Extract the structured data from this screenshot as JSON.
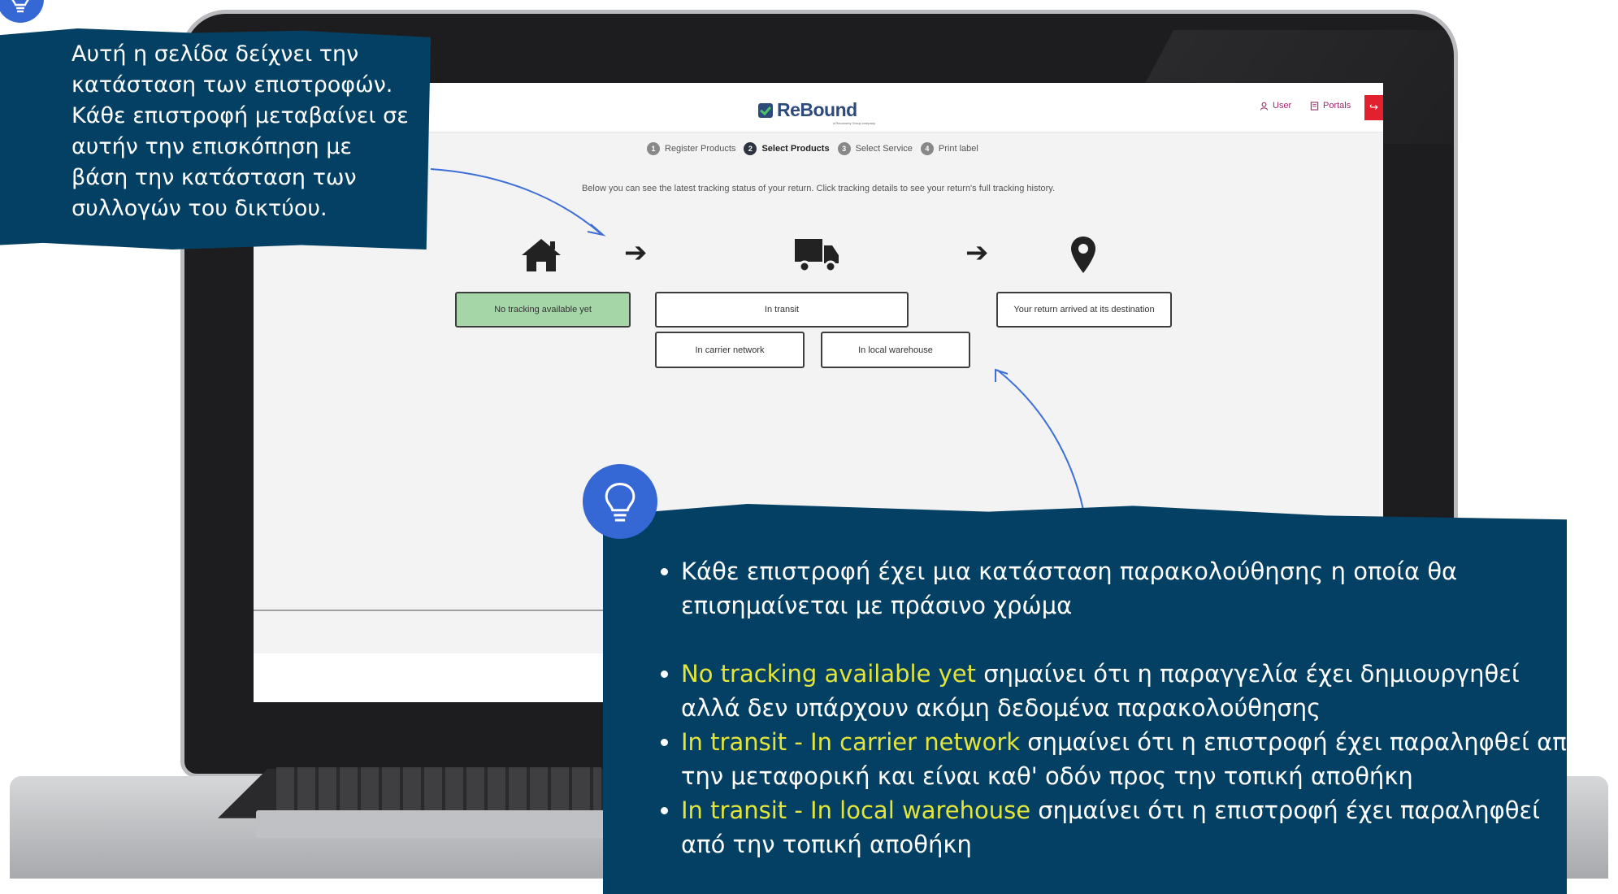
{
  "app": {
    "logo_text": "ReBound",
    "logo_subtext": "a Reconomy Group company",
    "user_label": "User",
    "portals_label": "Portals"
  },
  "steps": [
    {
      "num": "1",
      "label": "Register Products"
    },
    {
      "num": "2",
      "label": "Select Products"
    },
    {
      "num": "3",
      "label": "Select Service"
    },
    {
      "num": "4",
      "label": "Print label"
    }
  ],
  "active_step": 2,
  "intro_text": "Below you can see the latest tracking status of your return. Click tracking details to see your return's full tracking history.",
  "statuses": {
    "none": "No tracking available yet",
    "transit": "In transit",
    "carrier": "In carrier network",
    "warehouse": "In local warehouse",
    "arrived": "Your return arrived at its destination"
  },
  "icons": [
    "home-icon",
    "truck-icon",
    "location-pin-icon",
    "arrow-right-icon",
    "lightbulb-icon",
    "user-icon",
    "portals-icon",
    "logout-icon"
  ],
  "colors": {
    "callout_bg": "#044063",
    "highlight": "#e3e53a",
    "bulb": "#3568d4",
    "current_status": "#a5d6a7",
    "brand": "#2d4a7a"
  },
  "callout_top": {
    "text": "Αυτή η σελίδα δείχνει την κατάσταση των επιστροφών. Κάθε επιστροφή μεταβαίνει σε αυτήν την επισκόπηση με βάση την κατάσταση των συλλογών του δικτύου."
  },
  "callout_bottom": {
    "b1": "Κάθε επιστροφή έχει μια κατάσταση παρακολούθησης η οποία θα επισημαίνεται με πράσινο χρώμα",
    "b2_hl": "No tracking available yet",
    "b2": " σημαίνει ότι η παραγγελία έχει δημιουργηθεί αλλά δεν υπάρχουν ακόμη δεδομένα παρακολούθησης",
    "b3_hl": "In transit - In carrier network",
    "b3": " σημαίνει ότι η επιστροφή έχει παραληφθεί από την μεταφορική και είναι καθ' οδόν προς την τοπική αποθήκη",
    "b4_hl": "In transit - In local warehouse",
    "b4": " σημαίνει ότι η επιστροφή έχει παραληφθεί από την τοπική αποθήκη"
  }
}
